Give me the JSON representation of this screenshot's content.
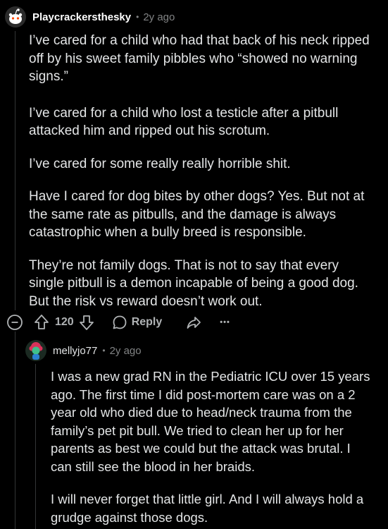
{
  "comment1": {
    "username": "Playcrackersthesky",
    "dot": "•",
    "time": "2y ago",
    "paragraphs": [
      "I’ve cared for a child who had that back of his neck ripped off by his sweet family pibbles who “showed no warning signs.”",
      "I’ve cared for a child who lost a testicle after a pitbull attacked him and ripped out his scrotum.",
      "I’ve cared for some really really horrible shit.",
      "Have I cared for dog bites by other dogs? Yes. But not at the same rate as pitbulls, and the damage is always catastrophic when a bully breed is responsible.",
      "They’re not family dogs. That is not to say that every single pitbull is a demon incapable of being a good dog. But the risk vs reward doesn’t work out."
    ],
    "votes": "120",
    "reply_label": "Reply",
    "more_label": "•••"
  },
  "comment2": {
    "username": "mellyjo77",
    "dot": "•",
    "time": "2y ago",
    "paragraphs": [
      "I was a new grad RN in the Pediatric ICU over 15 years ago. The first time I did post-mortem care was on a 2 year old who died due to head/neck trauma from the family’s pet pit bull. We tried to clean her up for her parents as best we could but the attack was brutal. I can still see the blood in her braids.",
      "I will never forget that little girl. And I will always hold a grudge against those dogs."
    ]
  },
  "colors": {
    "background": "#000000",
    "text": "#e3e5e6",
    "muted": "#818384",
    "thread": "#343536"
  }
}
